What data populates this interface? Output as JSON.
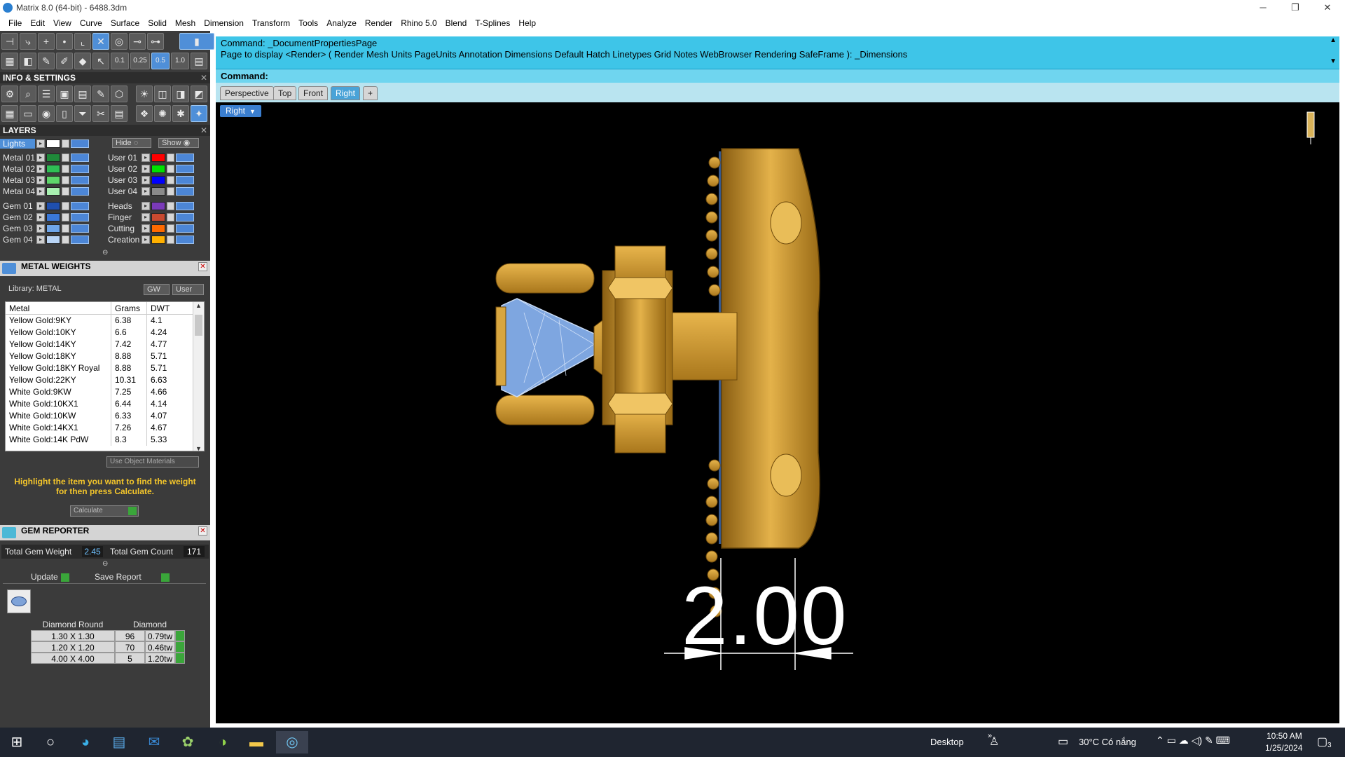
{
  "window": {
    "title": "Matrix 8.0 (64-bit) - 6488.3dm"
  },
  "menu": [
    "File",
    "Edit",
    "View",
    "Curve",
    "Surface",
    "Solid",
    "Mesh",
    "Dimension",
    "Transform",
    "Tools",
    "Analyze",
    "Render",
    "Rhino 5.0",
    "Blend",
    "T-Splines",
    "Help"
  ],
  "toolbar": {
    "presets": [
      "0.1",
      "0.25",
      "0.5",
      "1.0"
    ]
  },
  "info_settings": {
    "title": "INFO & SETTINGS"
  },
  "layers": {
    "title": "LAYERS",
    "lights_label": "Lights",
    "hide_label": "Hide",
    "show_label": "Show",
    "left": [
      {
        "name": "Metal 01",
        "color": "#1f8a3a"
      },
      {
        "name": "Metal 02",
        "color": "#2fbf55"
      },
      {
        "name": "Metal 03",
        "color": "#5ed66a"
      },
      {
        "name": "Metal 04",
        "color": "#a8f0b0"
      },
      {
        "name": "Gem 01",
        "color": "#1f4fae"
      },
      {
        "name": "Gem 02",
        "color": "#3a78d8"
      },
      {
        "name": "Gem 03",
        "color": "#6fa6ea"
      },
      {
        "name": "Gem 04",
        "color": "#b9d4f5"
      }
    ],
    "right": [
      {
        "name": "User 01",
        "color": "#ff0000"
      },
      {
        "name": "User 02",
        "color": "#00e000"
      },
      {
        "name": "User 03",
        "color": "#0000ff"
      },
      {
        "name": "User 04",
        "color": "#8a8a8a"
      },
      {
        "name": "Heads",
        "color": "#7a3ab8"
      },
      {
        "name": "Finger",
        "color": "#c84a30"
      },
      {
        "name": "Cutting",
        "color": "#ff6a00"
      },
      {
        "name": "Creation",
        "color": "#ffb000"
      }
    ]
  },
  "metal_weights": {
    "title": "METAL WEIGHTS",
    "library": "Library: METAL",
    "gw_label": "GW",
    "user_label": "User",
    "columns": [
      "Metal",
      "Grams",
      "DWT"
    ],
    "rows": [
      [
        "Yellow Gold:9KY",
        "6.38",
        "4.1"
      ],
      [
        "Yellow Gold:10KY",
        "6.6",
        "4.24"
      ],
      [
        "Yellow Gold:14KY",
        "7.42",
        "4.77"
      ],
      [
        "Yellow Gold:18KY",
        "8.88",
        "5.71"
      ],
      [
        "Yellow Gold:18KY Royal",
        "8.88",
        "5.71"
      ],
      [
        "Yellow Gold:22KY",
        "10.31",
        "6.63"
      ],
      [
        "White Gold:9KW",
        "7.25",
        "4.66"
      ],
      [
        "White Gold:10KX1",
        "6.44",
        "4.14"
      ],
      [
        "White Gold:10KW",
        "6.33",
        "4.07"
      ],
      [
        "White Gold:14KX1",
        "7.26",
        "4.67"
      ],
      [
        "White Gold:14K PdW",
        "8.3",
        "5.33"
      ]
    ],
    "use_object_materials": "Use Object Materials",
    "hint": "Highlight the item you want to find the weight for then press Calculate.",
    "calculate_label": "Calculate"
  },
  "gem_reporter": {
    "title": "GEM REPORTER",
    "total_weight_label": "Total Gem Weight",
    "total_weight": "2.45",
    "total_count_label": "Total Gem Count",
    "total_count": "171",
    "update_label": "Update",
    "save_label": "Save Report",
    "header": [
      "Diamond Round",
      "Diamond"
    ],
    "rows": [
      [
        "1.30 X 1.30",
        "96",
        "0.79tw"
      ],
      [
        "1.20 X 1.20",
        "70",
        "0.46tw"
      ],
      [
        "4.00 X 4.00",
        "5",
        "1.20tw"
      ]
    ]
  },
  "command": {
    "line1": "Command: _DocumentPropertiesPage",
    "line2": "Page to display <Render> ( Render  Mesh  Units  PageUnits  Annotation  Dimensions  Default  Hatch  Linetypes  Grid  Notes  WebBrowser  Rendering  SafeFrame ): _Dimensions",
    "prompt": "Command:"
  },
  "viewport": {
    "tabs": [
      "Perspective",
      "Top",
      "Front",
      "Right"
    ],
    "active_tab": "Right",
    "label": "Right",
    "dimension": "2.00"
  },
  "taskbar": {
    "desktop": "Desktop",
    "weather": "30°C  Có nắng",
    "time": "10:50 AM",
    "date": "1/25/2024",
    "notifications": "3"
  }
}
